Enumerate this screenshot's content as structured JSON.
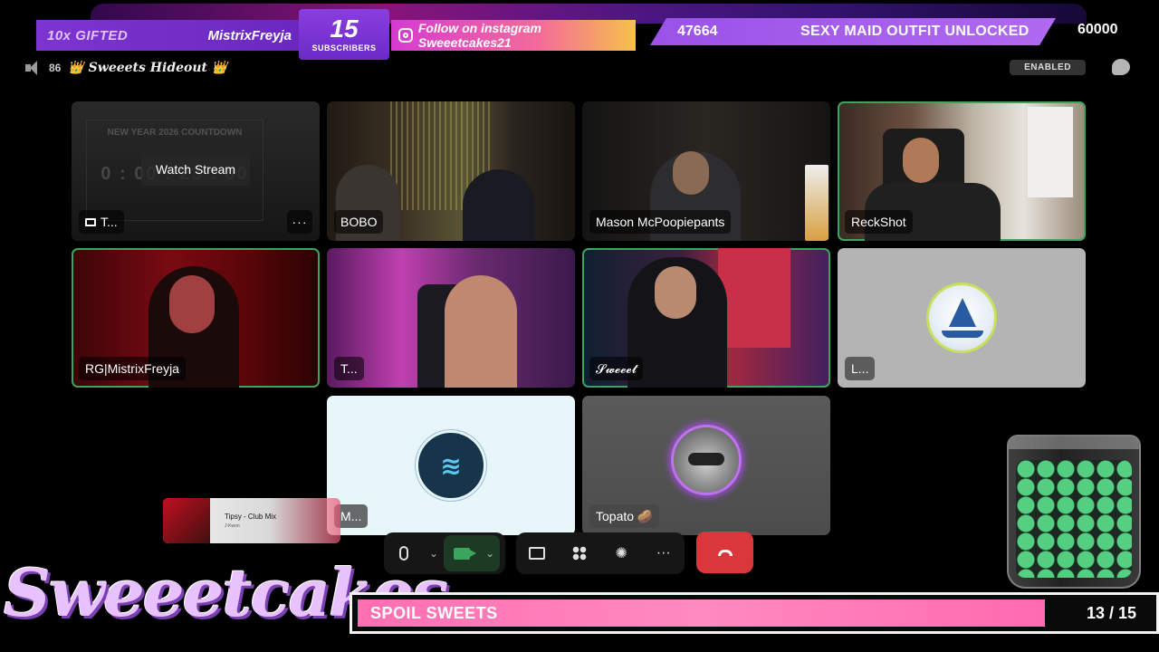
{
  "overlay": {
    "gifted_label": "10x GIFTED",
    "gifter": "MistrixFreyja",
    "subscribers": {
      "count": "15",
      "label": "SUBSCRIBERS"
    },
    "instagram_text": "Follow on instagram Sweeetcakes21",
    "goal": {
      "current": "47664",
      "title": "SEXY MAID OUTFIT UNLOCKED",
      "target": "60000"
    }
  },
  "channel": {
    "count": "86",
    "name": "👑 Sweeets Hideout 👑",
    "enabled_badge": "ENABLED"
  },
  "tiles": [
    {
      "id": "t1",
      "name": "T...",
      "action": "Watch Stream",
      "more": "···",
      "countdown_title": "NEW YEAR 2026 COUNTDOWN",
      "countdown_digits": "0 : 00 : 23 : 00"
    },
    {
      "id": "t2",
      "name": "BOBO"
    },
    {
      "id": "t3",
      "name": "Mason McPoopiepants"
    },
    {
      "id": "t4",
      "name": "ReckShot",
      "speaking": true
    },
    {
      "id": "t5",
      "name": "RG|MistrixFreyja",
      "speaking": true
    },
    {
      "id": "t6",
      "name": "T..."
    },
    {
      "id": "t7",
      "name": "𝓢𝔀𝓮𝓮𝓮𝓽",
      "speaking": true
    },
    {
      "id": "t8",
      "name": "L..."
    },
    {
      "id": "t9",
      "name": "M...",
      "avatar_glyph": "≋"
    },
    {
      "id": "t10",
      "name": "Topato 🥔"
    }
  ],
  "now_playing": {
    "song": "Tipsy - Club Mix",
    "artist": "J-Kwon"
  },
  "controls": {
    "mic_icon": "microphone-icon",
    "camera_icon": "camera-icon",
    "share_icon": "screen-share-icon",
    "activities_icon": "activities-icon",
    "soundboard_icon": "soundboard-icon",
    "more_label": "···",
    "hangup_icon": "hangup-icon"
  },
  "branding": {
    "logo": "Sweeetcakes"
  },
  "spoil": {
    "label": "SPOIL SWEETS",
    "current": 13,
    "total": 15,
    "count_text": "13 / 15"
  },
  "colors": {
    "speaking": "#3ba55d",
    "hangup": "#da373c",
    "accent_purple": "#7d35d0",
    "spoil_pink": "#ff6fb2"
  }
}
